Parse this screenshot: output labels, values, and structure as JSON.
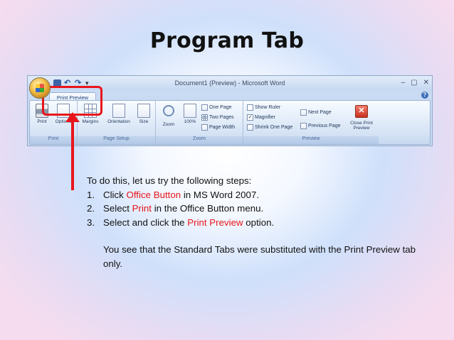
{
  "slide": {
    "title": "Program Tab"
  },
  "word_window": {
    "title": "Document1 (Preview) - Microsoft Word",
    "window_controls": [
      "–",
      "▢",
      "✕"
    ],
    "active_tab": "Print Preview",
    "help": "?",
    "groups": [
      {
        "label": "Print",
        "buttons": [
          "Print",
          "Options"
        ]
      },
      {
        "label": "Page Setup",
        "buttons": [
          "Margins",
          "Orientation",
          "Size"
        ]
      },
      {
        "label": "Zoom",
        "buttons": [
          "Zoom",
          "100%"
        ],
        "options": [
          "One Page",
          "Two Pages",
          "Page Width"
        ]
      },
      {
        "label": "Preview",
        "checkboxes": [
          "Show Ruler",
          "Magnifier",
          "Shrink One Page"
        ],
        "nav": [
          "Next Page",
          "Previous Page"
        ],
        "close_label": "Close Print Preview"
      }
    ],
    "magnifier_checked": "✓"
  },
  "content": {
    "intro": "To do this, let us try the following steps:",
    "steps": [
      {
        "num": "1.",
        "pre": "Click ",
        "highlight": "Office Button",
        "post": " in MS Word 2007."
      },
      {
        "num": "2.",
        "pre": "Select ",
        "highlight": "Print",
        "post": " in the Office Button menu."
      },
      {
        "num": "3.",
        "pre": "Select and click the ",
        "highlight": "Print Preview",
        "post": " option."
      }
    ],
    "note": "You see that the Standard Tabs were substituted with the Print Preview tab only."
  },
  "colors": {
    "annotation_red": "#e8151c",
    "ribbon_blue": "#c9dbf2"
  }
}
